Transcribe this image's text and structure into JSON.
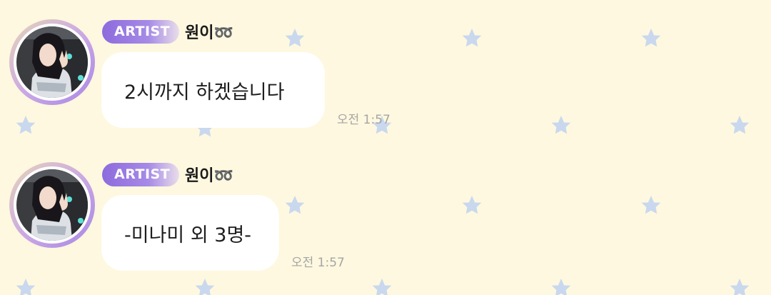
{
  "colors": {
    "background": "#FDF8DF",
    "star": "#C9D8EE",
    "badge_start": "#8D6BDD",
    "badge_end": "#E9DEEA",
    "bubble": "#FFFFFF",
    "timestamp": "#A5A5A5"
  },
  "messages": [
    {
      "badge": "ARTIST",
      "sender": "원이➿",
      "text": "2시까지 하겠습니다",
      "time": "오전 1:57"
    },
    {
      "badge": "ARTIST",
      "sender": "원이➿",
      "text": "-미나미 외 3명-",
      "time": "오전 1:57"
    }
  ]
}
